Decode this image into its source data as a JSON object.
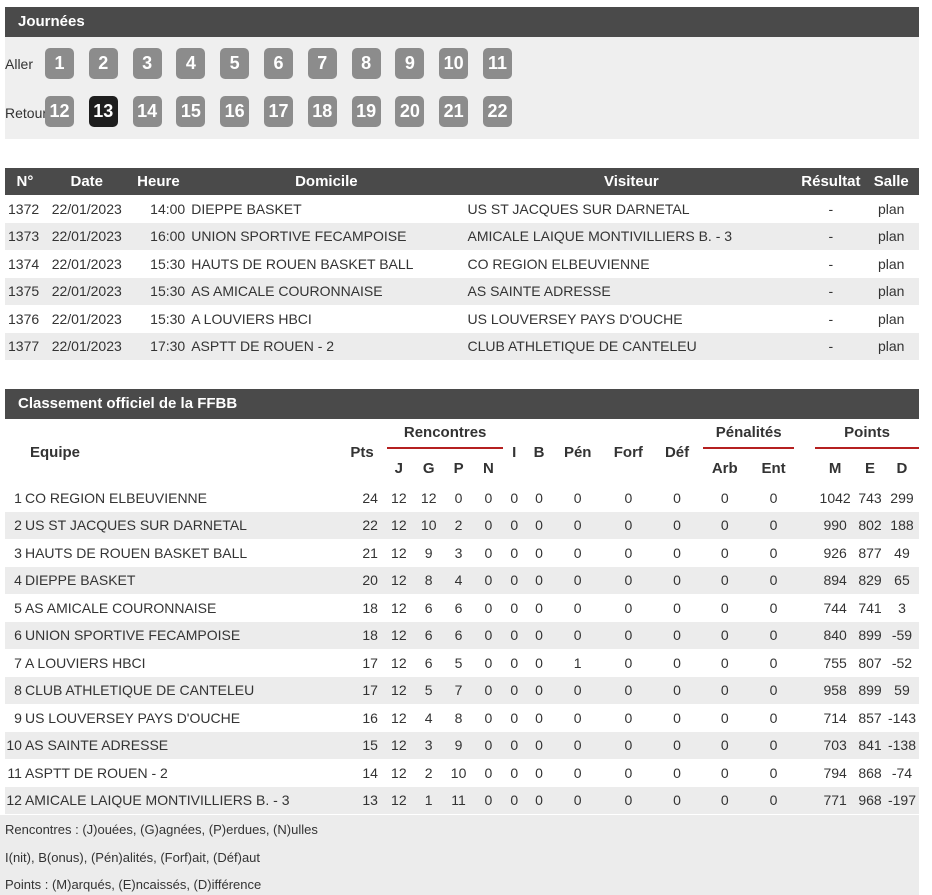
{
  "journees": {
    "title": "Journées",
    "aller_label": "Aller",
    "retour_label": "Retour",
    "aller": [
      "1",
      "2",
      "3",
      "4",
      "5",
      "6",
      "7",
      "8",
      "9",
      "10",
      "11"
    ],
    "retour": [
      "12",
      "13",
      "14",
      "15",
      "16",
      "17",
      "18",
      "19",
      "20",
      "21",
      "22"
    ],
    "active": "13"
  },
  "matches": {
    "headers": [
      "N°",
      "Date",
      "Heure",
      "Domicile",
      "Visiteur",
      "Résultat",
      "Salle"
    ],
    "rows": [
      {
        "num": "1372",
        "date": "22/01/2023",
        "heure": "14:00",
        "domicile": "DIEPPE BASKET",
        "visiteur": "US ST JACQUES SUR DARNETAL",
        "resultat": "-",
        "salle": "plan"
      },
      {
        "num": "1373",
        "date": "22/01/2023",
        "heure": "16:00",
        "domicile": "UNION SPORTIVE FECAMPOISE",
        "visiteur": "AMICALE LAIQUE MONTIVILLIERS B. - 3",
        "resultat": "-",
        "salle": "plan"
      },
      {
        "num": "1374",
        "date": "22/01/2023",
        "heure": "15:30",
        "domicile": "HAUTS DE ROUEN BASKET BALL",
        "visiteur": "CO REGION ELBEUVIENNE",
        "resultat": "-",
        "salle": "plan"
      },
      {
        "num": "1375",
        "date": "22/01/2023",
        "heure": "15:30",
        "domicile": "AS AMICALE COURONNAISE",
        "visiteur": "AS SAINTE ADRESSE",
        "resultat": "-",
        "salle": "plan"
      },
      {
        "num": "1376",
        "date": "22/01/2023",
        "heure": "15:30",
        "domicile": "A LOUVIERS HBCI",
        "visiteur": "US LOUVERSEY PAYS D'OUCHE",
        "resultat": "-",
        "salle": "plan"
      },
      {
        "num": "1377",
        "date": "22/01/2023",
        "heure": "17:30",
        "domicile": "ASPTT DE ROUEN - 2",
        "visiteur": "CLUB ATHLETIQUE DE CANTELEU",
        "resultat": "-",
        "salle": "plan"
      }
    ]
  },
  "classement": {
    "title": "Classement officiel de la FFBB",
    "headers": {
      "equipe": "Equipe",
      "pts": "Pts",
      "rencontres": "Rencontres",
      "j": "J",
      "g": "G",
      "p": "P",
      "n": "N",
      "i": "I",
      "b": "B",
      "pen": "Pén",
      "forf": "Forf",
      "def": "Déf",
      "penalites": "Pénalités",
      "arb": "Arb",
      "ent": "Ent",
      "points": "Points",
      "m": "M",
      "e": "E",
      "d": "D"
    },
    "rows": [
      {
        "rank": "1",
        "team": "CO REGION ELBEUVIENNE",
        "pts": "24",
        "j": "12",
        "g": "12",
        "p": "0",
        "n": "0",
        "i": "0",
        "b": "0",
        "pen": "0",
        "forf": "0",
        "def": "0",
        "arb": "0",
        "ent": "0",
        "m": "1042",
        "e": "743",
        "d": "299"
      },
      {
        "rank": "2",
        "team": "US ST JACQUES SUR DARNETAL",
        "pts": "22",
        "j": "12",
        "g": "10",
        "p": "2",
        "n": "0",
        "i": "0",
        "b": "0",
        "pen": "0",
        "forf": "0",
        "def": "0",
        "arb": "0",
        "ent": "0",
        "m": "990",
        "e": "802",
        "d": "188"
      },
      {
        "rank": "3",
        "team": "HAUTS DE ROUEN BASKET BALL",
        "pts": "21",
        "j": "12",
        "g": "9",
        "p": "3",
        "n": "0",
        "i": "0",
        "b": "0",
        "pen": "0",
        "forf": "0",
        "def": "0",
        "arb": "0",
        "ent": "0",
        "m": "926",
        "e": "877",
        "d": "49"
      },
      {
        "rank": "4",
        "team": "DIEPPE BASKET",
        "pts": "20",
        "j": "12",
        "g": "8",
        "p": "4",
        "n": "0",
        "i": "0",
        "b": "0",
        "pen": "0",
        "forf": "0",
        "def": "0",
        "arb": "0",
        "ent": "0",
        "m": "894",
        "e": "829",
        "d": "65"
      },
      {
        "rank": "5",
        "team": "AS AMICALE COURONNAISE",
        "pts": "18",
        "j": "12",
        "g": "6",
        "p": "6",
        "n": "0",
        "i": "0",
        "b": "0",
        "pen": "0",
        "forf": "0",
        "def": "0",
        "arb": "0",
        "ent": "0",
        "m": "744",
        "e": "741",
        "d": "3"
      },
      {
        "rank": "6",
        "team": "UNION SPORTIVE FECAMPOISE",
        "pts": "18",
        "j": "12",
        "g": "6",
        "p": "6",
        "n": "0",
        "i": "0",
        "b": "0",
        "pen": "0",
        "forf": "0",
        "def": "0",
        "arb": "0",
        "ent": "0",
        "m": "840",
        "e": "899",
        "d": "-59"
      },
      {
        "rank": "7",
        "team": "A LOUVIERS HBCI",
        "pts": "17",
        "j": "12",
        "g": "6",
        "p": "5",
        "n": "0",
        "i": "0",
        "b": "0",
        "pen": "1",
        "forf": "0",
        "def": "0",
        "arb": "0",
        "ent": "0",
        "m": "755",
        "e": "807",
        "d": "-52"
      },
      {
        "rank": "8",
        "team": "CLUB ATHLETIQUE DE CANTELEU",
        "pts": "17",
        "j": "12",
        "g": "5",
        "p": "7",
        "n": "0",
        "i": "0",
        "b": "0",
        "pen": "0",
        "forf": "0",
        "def": "0",
        "arb": "0",
        "ent": "0",
        "m": "958",
        "e": "899",
        "d": "59"
      },
      {
        "rank": "9",
        "team": "US LOUVERSEY PAYS D'OUCHE",
        "pts": "16",
        "j": "12",
        "g": "4",
        "p": "8",
        "n": "0",
        "i": "0",
        "b": "0",
        "pen": "0",
        "forf": "0",
        "def": "0",
        "arb": "0",
        "ent": "0",
        "m": "714",
        "e": "857",
        "d": "-143"
      },
      {
        "rank": "10",
        "team": "AS SAINTE ADRESSE",
        "pts": "15",
        "j": "12",
        "g": "3",
        "p": "9",
        "n": "0",
        "i": "0",
        "b": "0",
        "pen": "0",
        "forf": "0",
        "def": "0",
        "arb": "0",
        "ent": "0",
        "m": "703",
        "e": "841",
        "d": "-138"
      },
      {
        "rank": "11",
        "team": "ASPTT DE ROUEN - 2",
        "pts": "14",
        "j": "12",
        "g": "2",
        "p": "10",
        "n": "0",
        "i": "0",
        "b": "0",
        "pen": "0",
        "forf": "0",
        "def": "0",
        "arb": "0",
        "ent": "0",
        "m": "794",
        "e": "868",
        "d": "-74"
      },
      {
        "rank": "12",
        "team": "AMICALE LAIQUE MONTIVILLIERS B. - 3",
        "pts": "13",
        "j": "12",
        "g": "1",
        "p": "11",
        "n": "0",
        "i": "0",
        "b": "0",
        "pen": "0",
        "forf": "0",
        "def": "0",
        "arb": "0",
        "ent": "0",
        "m": "771",
        "e": "968",
        "d": "-197"
      }
    ]
  },
  "legend": [
    "Rencontres : (J)ouées, (G)agnées, (P)erdues, (N)ulles",
    "I(nit), B(onus), (Pén)alités, (Forf)ait, (Déf)aut",
    "Points : (M)arqués, (E)ncaissés, (D)ifférence"
  ],
  "colors": {
    "header_bg": "#4a4a4a",
    "active_day": "#1e1e1e",
    "day_btn": "#8c8c8c",
    "accent_line": "#b52020",
    "row_alt": "#ececec"
  }
}
